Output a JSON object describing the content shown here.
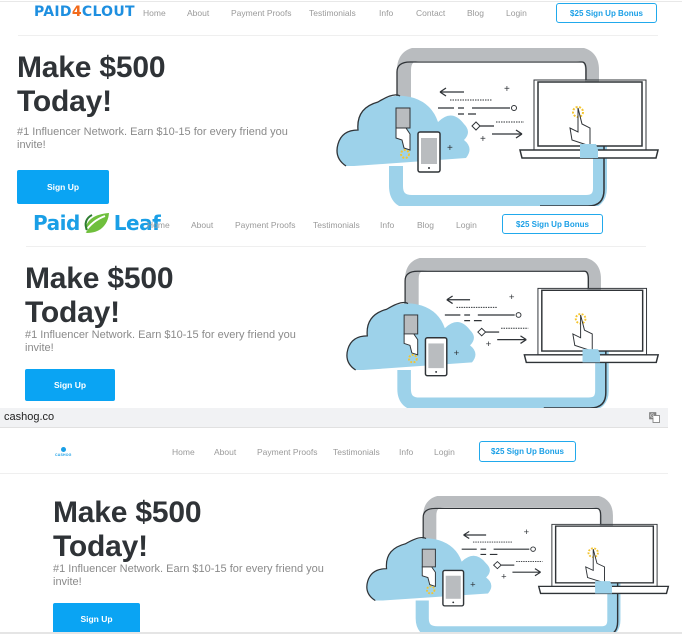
{
  "screens": [
    {
      "brand": "Paid4Clout",
      "logo": {
        "left": "PAID",
        "accent": "4",
        "right": "CLOUT",
        "accent_color": "#f26a1b",
        "color": "#1e8fe0"
      },
      "nav": [
        "Home",
        "About",
        "Payment Proofs",
        "Testimonials",
        "Info",
        "Contact",
        "Blog",
        "Login"
      ],
      "cta": "$25 Sign Up Bonus",
      "hero": {
        "headline_line1": "Make $500",
        "headline_line2": "Today!",
        "subtext": "#1 Influencer Network. Earn $10-15 for every friend you invite!",
        "button": "Sign Up"
      }
    },
    {
      "brand": "PaidLeaf",
      "logo": {
        "left": "Paid",
        "right": "Leaf",
        "icon": "leaf-icon",
        "color": "#1a9fe6",
        "leaf_color": "#4aa53a"
      },
      "nav": [
        "Home",
        "About",
        "Payment Proofs",
        "Testimonials",
        "Info",
        "Blog",
        "Login"
      ],
      "cta": "$25 Sign Up Bonus",
      "hero": {
        "headline_line1": "Make $500",
        "headline_line2": "Today!",
        "subtext": "#1 Influencer Network. Earn $10-15 for every friend you invite!",
        "button": "Sign Up"
      }
    },
    {
      "brand": "Cashog",
      "url": "cashog.co",
      "logo": {
        "text": "CASHOG",
        "color": "#1a9fe6"
      },
      "nav": [
        "Home",
        "About",
        "Payment Proofs",
        "Testimonials",
        "Info",
        "Login"
      ],
      "cta": "$25 Sign Up Bonus",
      "hero": {
        "headline_line1": "Make $500",
        "headline_line2": "Today!",
        "subtext": "#1 Influencer Network. Earn $10-15 for every friend you invite!",
        "button": "Sign Up"
      }
    }
  ],
  "colors": {
    "accent": "#0aa4f3",
    "cta_border": "#21a9ec",
    "headline": "#2f3337",
    "cloud": "#9dd2ea",
    "pipe_gray": "#b9bcbf",
    "highlight": "#f4c531"
  }
}
